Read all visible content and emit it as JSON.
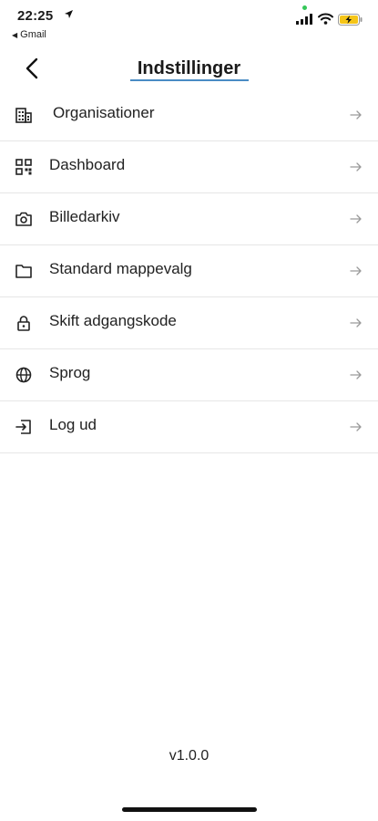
{
  "status_bar": {
    "time": "22:25",
    "back_app": "Gmail",
    "battery_color": "#f5c518",
    "indicator_color": "#35c759"
  },
  "header": {
    "title": "Indstillinger",
    "back_icon": "chevron-left-icon",
    "accent_color": "#4a8cc4"
  },
  "menu": {
    "items": [
      {
        "label": "Organisationer",
        "icon": "building-icon"
      },
      {
        "label": "Dashboard",
        "icon": "qr-grid-icon"
      },
      {
        "label": "Billedarkiv",
        "icon": "camera-icon"
      },
      {
        "label": "Standard mappevalg",
        "icon": "folder-icon"
      },
      {
        "label": "Skift adgangskode",
        "icon": "lock-icon"
      },
      {
        "label": "Sprog",
        "icon": "globe-icon"
      },
      {
        "label": "Log ud",
        "icon": "logout-icon"
      }
    ],
    "arrow_icon": "arrow-right-icon"
  },
  "footer": {
    "version": "v1.0.0"
  }
}
